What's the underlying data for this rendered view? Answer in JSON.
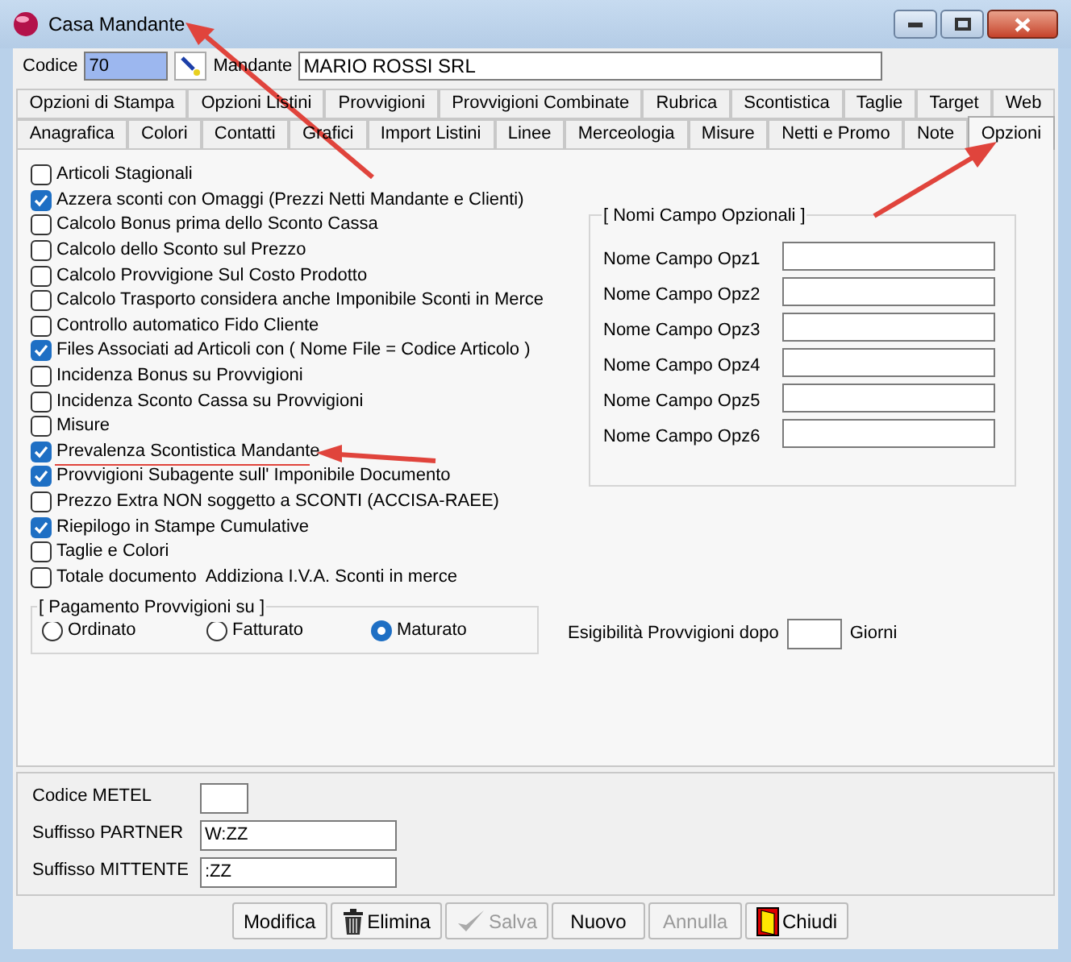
{
  "window": {
    "title": "Casa Mandante"
  },
  "header": {
    "code_label": "Codice",
    "code_value": "70",
    "name_label": "Mandante",
    "name_value": "MARIO ROSSI SRL"
  },
  "tab_rows": [
    {
      "tabs": [
        {
          "label": "Opzioni di Stampa",
          "selected": false
        },
        {
          "label": "Opzioni Listini",
          "selected": false
        },
        {
          "label": "Provvigioni",
          "selected": false
        },
        {
          "label": "Provvigioni Combinate",
          "selected": false
        },
        {
          "label": "Rubrica",
          "selected": false
        },
        {
          "label": "Scontistica",
          "selected": false
        },
        {
          "label": "Taglie",
          "selected": false
        },
        {
          "label": "Target",
          "selected": false
        },
        {
          "label": "Web",
          "selected": false
        }
      ]
    },
    {
      "tabs": [
        {
          "label": "Anagrafica",
          "selected": false
        },
        {
          "label": "Colori",
          "selected": false
        },
        {
          "label": "Contatti",
          "selected": false
        },
        {
          "label": "Grafici",
          "selected": false
        },
        {
          "label": "Import Listini",
          "selected": false
        },
        {
          "label": "Linee",
          "selected": false
        },
        {
          "label": "Merceologia",
          "selected": false
        },
        {
          "label": "Misure",
          "selected": false
        },
        {
          "label": "Netti e Promo",
          "selected": false
        },
        {
          "label": "Note",
          "selected": false
        },
        {
          "label": "Opzioni",
          "selected": true
        }
      ]
    }
  ],
  "options": [
    {
      "label": "Articoli Stagionali",
      "checked": false
    },
    {
      "label": "Azzera sconti con Omaggi (Prezzi Netti Mandante e Clienti)",
      "checked": true
    },
    {
      "label": "Calcolo Bonus prima dello Sconto Cassa",
      "checked": false
    },
    {
      "label": "Calcolo dello Sconto sul Prezzo",
      "checked": false
    },
    {
      "label": "Calcolo Provvigione Sul Costo Prodotto",
      "checked": false
    },
    {
      "label": "Calcolo Trasporto considera anche Imponibile Sconti in Merce",
      "checked": false
    },
    {
      "label": "Controllo automatico Fido Cliente",
      "checked": false
    },
    {
      "label": "Files Associati ad Articoli con ( Nome File = Codice Articolo )",
      "checked": true
    },
    {
      "label": "Incidenza Bonus su Provvigioni",
      "checked": false
    },
    {
      "label": "Incidenza Sconto Cassa su Provvigioni",
      "checked": false
    },
    {
      "label": "Misure",
      "checked": false
    },
    {
      "label": "Prevalenza Scontistica Mandante",
      "checked": true
    },
    {
      "label": "Provvigioni Subagente sull' Imponibile Documento",
      "checked": true
    },
    {
      "label": "Prezzo Extra NON soggetto a SCONTI (ACCISA-RAEE)",
      "checked": false
    },
    {
      "label": "Riepilogo in Stampe Cumulative",
      "checked": true
    },
    {
      "label": "Taglie e Colori",
      "checked": false
    },
    {
      "label": "Totale documento  Addiziona I.V.A. Sconti in merce",
      "checked": false
    }
  ],
  "payment": {
    "title": "[ Pagamento Provvigioni su ]",
    "choices": [
      {
        "label": "Ordinato",
        "selected": false
      },
      {
        "label": "Fatturato",
        "selected": false
      },
      {
        "label": "Maturato",
        "selected": true
      }
    ]
  },
  "optional_fields": {
    "title": "[ Nomi Campo Opzionali ]",
    "fields": [
      {
        "label": "Nome Campo Opz1"
      },
      {
        "label": "Nome Campo Opz2"
      },
      {
        "label": "Nome Campo Opz3"
      },
      {
        "label": "Nome Campo Opz4"
      },
      {
        "label": "Nome Campo Opz5"
      },
      {
        "label": "Nome Campo Opz6"
      }
    ]
  },
  "due": {
    "label": "Esigibilità Provvigioni dopo",
    "unit": "Giorni"
  },
  "codes": [
    {
      "label": "Codice METEL",
      "kind": "short"
    },
    {
      "label": "Suffisso PARTNER",
      "value": "W:ZZ",
      "kind": "wide"
    },
    {
      "label": "Suffisso MITTENTE",
      "value": ":ZZ",
      "kind": "wide"
    }
  ],
  "buttons": [
    {
      "label": "Modifica",
      "disabled": false
    },
    {
      "label": "Elimina",
      "disabled": false
    },
    {
      "label": "Salva",
      "disabled": true
    },
    {
      "label": "Nuovo",
      "disabled": false
    },
    {
      "label": "Annulla",
      "disabled": true
    },
    {
      "label": "Chiudi",
      "disabled": false
    }
  ]
}
